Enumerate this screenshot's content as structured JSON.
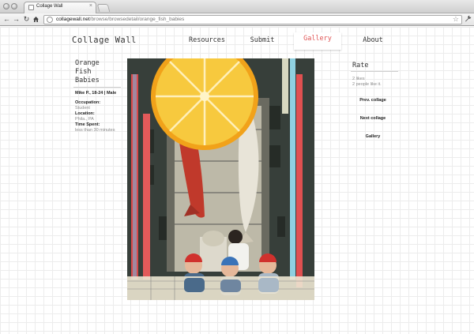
{
  "browser": {
    "tab_title": "Collage Wall",
    "tab_close": "×",
    "url_domain": "collagewall.net",
    "url_path": "/browse/browsedetail/orange_fish_babies"
  },
  "site": {
    "logo": "Collage Wall",
    "nav": [
      "Resources",
      "Submit",
      "Gallery",
      "About"
    ],
    "active_nav": "Gallery",
    "accent_color": "#e05757"
  },
  "collage": {
    "title_lines": [
      "Orange",
      "Fish",
      "Babies"
    ],
    "author": "Mike P., 18-24 | Male",
    "occupation_label": "Occupation:",
    "occupation": "Student",
    "location_label": "Location:",
    "location": "Phila., PA",
    "time_label": "Time Spent:",
    "time": "less than 30 minutes"
  },
  "sidebar": {
    "rate_title": "Rate",
    "likes": "2 likes",
    "people_like": "2 people like it.",
    "prev_label": "Prev. collage",
    "next_label": "Next collage",
    "gallery_label": "Gallery"
  },
  "icons": {
    "back": "back-arrow-icon",
    "forward": "forward-arrow-icon",
    "reload": "reload-icon",
    "home": "home-icon",
    "bookmark": "star-icon",
    "settings": "wrench-icon"
  }
}
